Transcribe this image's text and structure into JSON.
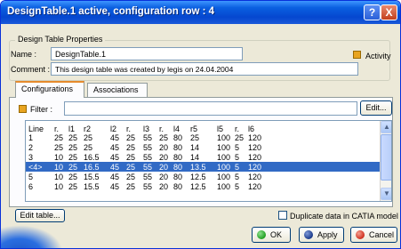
{
  "window": {
    "title": "DesignTable.1 active, configuration row : 4"
  },
  "titlebar_buttons": {
    "help": "?",
    "close": "X"
  },
  "properties": {
    "group_label": "Design Table Properties",
    "name_label": "Name :",
    "name_value": "DesignTable.1",
    "comment_label": "Comment :",
    "comment_value": "This design table was created by legis on 24.04.2004",
    "activity_label": "Activity"
  },
  "tabs": [
    {
      "label": "Configurations",
      "active": true
    },
    {
      "label": "Associations",
      "active": false
    }
  ],
  "filter": {
    "label": "Filter :",
    "value": "",
    "edit_button": "Edit..."
  },
  "table": {
    "columns": [
      "Line",
      "r.",
      "l1",
      "r2",
      "l2",
      "r.",
      "l3",
      "r.",
      "l4",
      "r5",
      "l5",
      "r.",
      "l6"
    ],
    "rows": [
      {
        "cells": [
          "1",
          "25",
          "25",
          "25",
          "45",
          "25",
          "55",
          "25",
          "80",
          "25",
          "100",
          "25",
          "120"
        ],
        "selected": false
      },
      {
        "cells": [
          "2",
          "25",
          "25",
          "25",
          "45",
          "25",
          "55",
          "20",
          "80",
          "14",
          "100",
          "5",
          "120"
        ],
        "selected": false
      },
      {
        "cells": [
          "3",
          "10",
          "25",
          "16.5",
          "45",
          "25",
          "55",
          "20",
          "80",
          "14",
          "100",
          "5",
          "120"
        ],
        "selected": false
      },
      {
        "cells": [
          "<4>",
          "10",
          "25",
          "16.5",
          "45",
          "25",
          "55",
          "20",
          "80",
          "13.5",
          "100",
          "5",
          "120"
        ],
        "selected": true
      },
      {
        "cells": [
          "5",
          "10",
          "25",
          "15.5",
          "45",
          "25",
          "55",
          "20",
          "80",
          "12.5",
          "100",
          "5",
          "120"
        ],
        "selected": false
      },
      {
        "cells": [
          "6",
          "10",
          "25",
          "15.5",
          "45",
          "25",
          "55",
          "20",
          "80",
          "12.5",
          "100",
          "5",
          "120"
        ],
        "selected": false
      }
    ]
  },
  "footer": {
    "edit_table_button": "Edit table...",
    "duplicate_label": "Duplicate data in CATIA model",
    "duplicate_checked": false,
    "ok_button": "OK",
    "apply_button": "Apply",
    "cancel_button": "Cancel"
  },
  "icons": {
    "activity": "activity-icon",
    "filter": "filter-icon",
    "ok": "ok-icon",
    "apply": "apply-icon",
    "cancel": "cancel-icon"
  },
  "colors": {
    "titlebar": "#0a5fe0",
    "selection": "#316ac5",
    "ok_icon": "#22a022",
    "apply_icon": "#1a3a8a",
    "cancel_icon": "#d03020"
  }
}
